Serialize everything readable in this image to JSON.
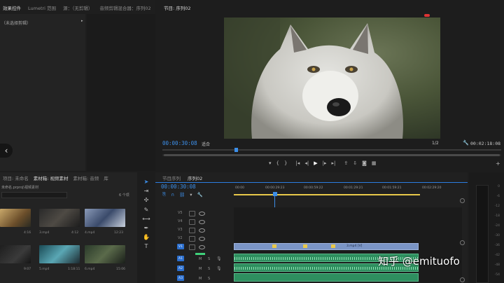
{
  "colors": {
    "accent": "#2b7de0",
    "playhead": "#3c8ee8",
    "video_clip": "#7b95c6",
    "audio_clip": "#2e8f5f",
    "highlight": "#e8c84a",
    "rec_red": "#d33"
  },
  "effect_controls": {
    "tabs": [
      "效果控件",
      "Lumetri 范围",
      "源：（无剪辑）",
      "音频剪辑混合器：序列02"
    ],
    "active_tab": 0,
    "body_text": "（未选择剪辑）"
  },
  "program_monitor": {
    "title": "节目: 序列02",
    "timecode": "00:00:30:08",
    "fit_label": "适合",
    "quality": "1/2",
    "duration": "00:02:18:08"
  },
  "transport": {
    "icons": [
      "marker-icon",
      "mark-in-icon",
      "mark-out-icon",
      "go-to-in-icon",
      "step-back-icon",
      "play-icon",
      "step-forward-icon",
      "go-to-out-icon",
      "lift-icon",
      "extract-icon",
      "export-frame-icon",
      "button-editor-icon"
    ]
  },
  "project": {
    "tabs": [
      "项目: 未命名",
      "素材箱: 视频素材",
      "素材箱: 音频",
      "库"
    ],
    "active_tab": 1,
    "path": "未命名.prproj\\视频素材",
    "item_count": "6 个项",
    "clips": [
      {
        "name": "1.mp4",
        "duration": "4:16"
      },
      {
        "name": "3.mp4",
        "duration": "4:12"
      },
      {
        "name": "4.mp4",
        "duration": "12:23"
      },
      {
        "name": "2.mp4",
        "duration": "9:07"
      },
      {
        "name": "5.mp4",
        "duration": "1:18:11"
      },
      {
        "name": "6.mp4",
        "duration": "15:06"
      }
    ]
  },
  "timeline": {
    "tabs": [
      "节目序列",
      "序列02"
    ],
    "active_tab": 1,
    "timecode": "00:00:30:08",
    "ruler": [
      "00:00",
      "00:00:29:23",
      "00:00:59:22",
      "00:01:29:21",
      "00:01:59:21",
      "00:02:29:20"
    ],
    "video_tracks": [
      "V5",
      "V4",
      "V3",
      "V2",
      "V1"
    ],
    "audio_tracks": [
      "A1",
      "A2",
      "A3"
    ],
    "clip_label": "3.mp4 [V]",
    "meter_scale": [
      "0",
      "-6",
      "-12",
      "-18",
      "-24",
      "-30",
      "-36",
      "-42",
      "-48",
      "-54"
    ]
  },
  "watermark": "知乎 @emituofo"
}
